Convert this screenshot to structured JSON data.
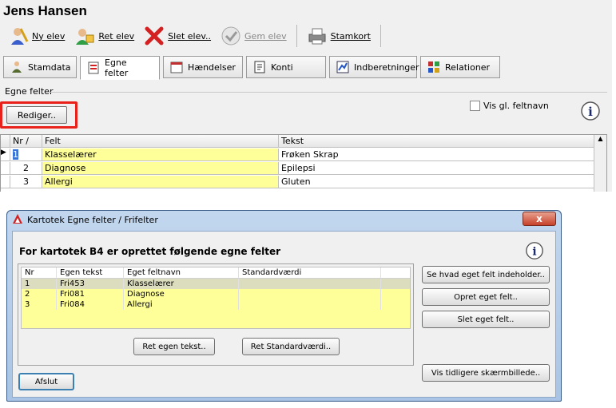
{
  "app": {
    "title": "Jens Hansen"
  },
  "toolbar": {
    "ny_elev": "Ny elev",
    "ret_elev": "Ret elev",
    "slet_elev": "Slet elev..",
    "gem_elev": "Gem elev",
    "stamkort": "Stamkort"
  },
  "tabs": [
    "Stamdata",
    "Egne felter",
    "Hændelser",
    "Konti",
    "Indberetninger",
    "Relationer"
  ],
  "egne": {
    "section_label": "Egne felter",
    "rediger": "Rediger..",
    "vis_gl": "Vis gl. feltnavn",
    "grid_headers": {
      "nr": "Nr",
      "felt": "Felt",
      "tekst": "Tekst"
    },
    "rows": [
      {
        "nr": "1",
        "felt": "Klasselærer",
        "tekst": "Frøken Skrap"
      },
      {
        "nr": "2",
        "felt": "Diagnose",
        "tekst": "Epilepsi"
      },
      {
        "nr": "3",
        "felt": "Allergi",
        "tekst": "Gluten"
      }
    ]
  },
  "dialog": {
    "title": "Kartotek Egne felter / Frifelter",
    "close": "x",
    "heading": "For kartotek B4 er oprettet følgende egne felter",
    "headers": {
      "nr": "Nr",
      "egen_tekst": "Egen tekst",
      "eget_feltnavn": "Eget feltnavn",
      "standardvaerdi": "Standardværdi"
    },
    "rows": [
      {
        "nr": "1",
        "egen_tekst": "Fri453",
        "eget_feltnavn": "Klasselærer",
        "standardvaerdi": ""
      },
      {
        "nr": "2",
        "egen_tekst": "Fri081",
        "eget_feltnavn": "Diagnose",
        "standardvaerdi": ""
      },
      {
        "nr": "3",
        "egen_tekst": "Fri084",
        "eget_feltnavn": "Allergi",
        "standardvaerdi": ""
      }
    ],
    "buttons": {
      "ret_egen_tekst": "Ret egen tekst..",
      "ret_standardvaerdi": "Ret Standardværdi..",
      "se_hvad": "Se hvad eget felt indeholder..",
      "opret": "Opret eget felt..",
      "slet": "Slet eget felt..",
      "vis_tidligere": "Vis tidligere skærmbillede..",
      "afslut": "Afslut"
    }
  },
  "colors": {
    "highlight": "#e8221b",
    "field_yellow": "#ffff99",
    "titlebar": "#b9cfea"
  }
}
